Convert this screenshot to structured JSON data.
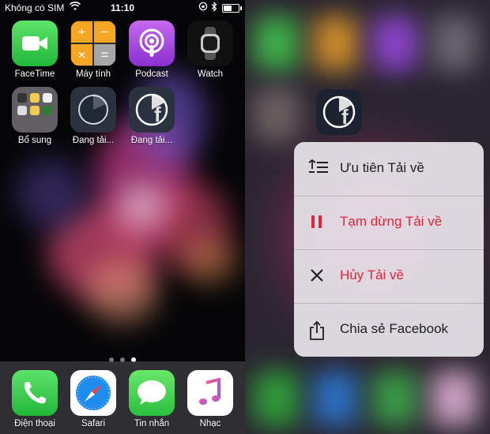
{
  "left": {
    "status": {
      "carrier": "Không có SIM",
      "time": "11:10"
    },
    "apps": [
      {
        "name": "FaceTime"
      },
      {
        "name": "Máy tính"
      },
      {
        "name": "Podcast"
      },
      {
        "name": "Watch"
      },
      {
        "name": "Bổ sung"
      },
      {
        "name": "Đang tải..."
      },
      {
        "name": "Đang tải..."
      }
    ],
    "dock": [
      {
        "name": "Điện thoại"
      },
      {
        "name": "Safari"
      },
      {
        "name": "Tin nhắn"
      },
      {
        "name": "Nhạc"
      }
    ],
    "calculator_keys": [
      "+",
      "−",
      "×",
      "="
    ]
  },
  "menu": {
    "items": [
      {
        "label": "Ưu tiên Tải về",
        "icon": "priority-list-icon",
        "color": "#1d1d22"
      },
      {
        "label": "Tạm dừng Tải về",
        "icon": "pause-icon",
        "color": "#e5243b"
      },
      {
        "label": "Hủy Tải về",
        "icon": "close-icon",
        "color": "#e5243b"
      },
      {
        "label": "Chia sẻ Facebook",
        "icon": "share-icon",
        "color": "#1d1d22"
      }
    ]
  },
  "colors": {
    "accent_red": "#e5243b",
    "menu_bg": "#e8e6ec"
  }
}
